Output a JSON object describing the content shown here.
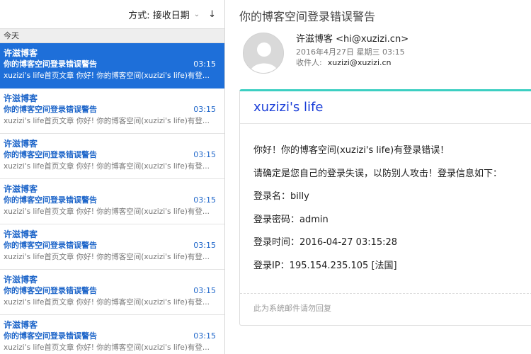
{
  "list": {
    "sort_label": "方式: 接收日期",
    "section_today": "今天",
    "items": [
      {
        "sender": "许滋博客",
        "subject": "你的博客空间登录错误警告",
        "time": "03:15",
        "preview": "xuzizi's life首页文章 你好!  你的博客空间(xuzizi's life)有登..."
      },
      {
        "sender": "许滋博客",
        "subject": "你的博客空间登录错误警告",
        "time": "03:15",
        "preview": "xuzizi's life首页文章 你好!  你的博客空间(xuzizi's life)有登..."
      },
      {
        "sender": "许滋博客",
        "subject": "你的博客空间登录错误警告",
        "time": "03:15",
        "preview": "xuzizi's life首页文章 你好!  你的博客空间(xuzizi's life)有登..."
      },
      {
        "sender": "许滋博客",
        "subject": "你的博客空间登录错误警告",
        "time": "03:15",
        "preview": "xuzizi's life首页文章 你好!  你的博客空间(xuzizi's life)有登..."
      },
      {
        "sender": "许滋博客",
        "subject": "你的博客空间登录错误警告",
        "time": "03:15",
        "preview": "xuzizi's life首页文章 你好!  你的博客空间(xuzizi's life)有登..."
      },
      {
        "sender": "许滋博客",
        "subject": "你的博客空间登录错误警告",
        "time": "03:15",
        "preview": "xuzizi's life首页文章 你好!  你的博客空间(xuzizi's life)有登..."
      },
      {
        "sender": "许滋博客",
        "subject": "你的博客空间登录错误警告",
        "time": "03:15",
        "preview": "xuzizi's life首页文章 你好!  你的博客空间(xuzizi's life)有登..."
      }
    ]
  },
  "message": {
    "title": "你的博客空间登录错误警告",
    "sender": "许滋博客 <hi@xuzizi.cn>",
    "date": "2016年4月27日 星期三 03:15",
    "recipient_label": "收件人:",
    "recipient_value": "xuzizi@xuzizi.cn",
    "blog_title": "xuzizi's life",
    "body_lines": [
      "你好！你的博客空间(xuzizi's life)有登录错误！",
      "请确定是您自己的登录失误，以防别人攻击！登录信息如下：",
      "登录名：billy",
      "登录密码：admin",
      "登录时间：2016-04-27 03:15:28",
      "登录IP：195.154.235.105 [法国]"
    ],
    "footer": "此为系统邮件请勿回复"
  },
  "colors": {
    "selection": "#1e6fd9",
    "unread_text": "#1d65c9",
    "card_accent": "#3ccfc2",
    "blog_title": "#1a3ed8"
  }
}
